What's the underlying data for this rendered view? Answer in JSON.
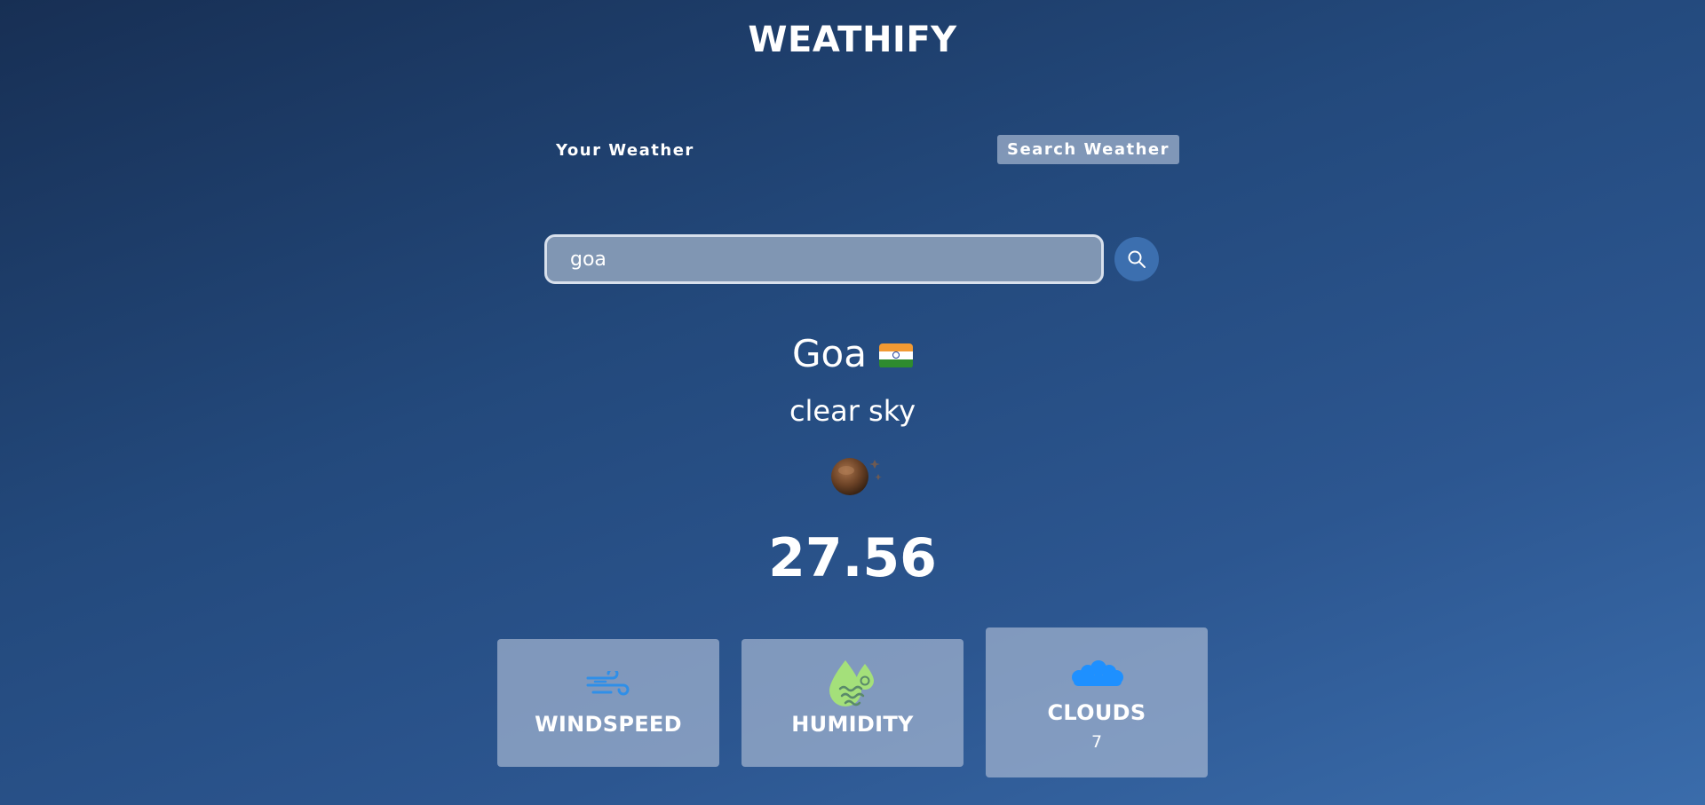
{
  "app": {
    "title": "WEATHIFY"
  },
  "tabs": {
    "your_weather": "Your Weather",
    "search_weather": "Search Weather"
  },
  "search": {
    "value": "goa",
    "icon": "search-icon"
  },
  "weather": {
    "city": "Goa",
    "country_flag": "india-flag-icon",
    "description": "clear sky",
    "icon": "moon-stars-icon",
    "temperature": "27.56"
  },
  "cards": {
    "windspeed": {
      "label": "WINDSPEED",
      "icon": "wind-icon"
    },
    "humidity": {
      "label": "HUMIDITY",
      "icon": "humidity-drops-icon"
    },
    "clouds": {
      "label": "CLOUDS",
      "value": "7",
      "icon": "cloud-icon"
    }
  },
  "colors": {
    "accent": "#3c6faf",
    "wind_icon": "#2f8fe8",
    "humidity_icon": "#a4e07a",
    "cloud_icon": "#1e90ff"
  }
}
